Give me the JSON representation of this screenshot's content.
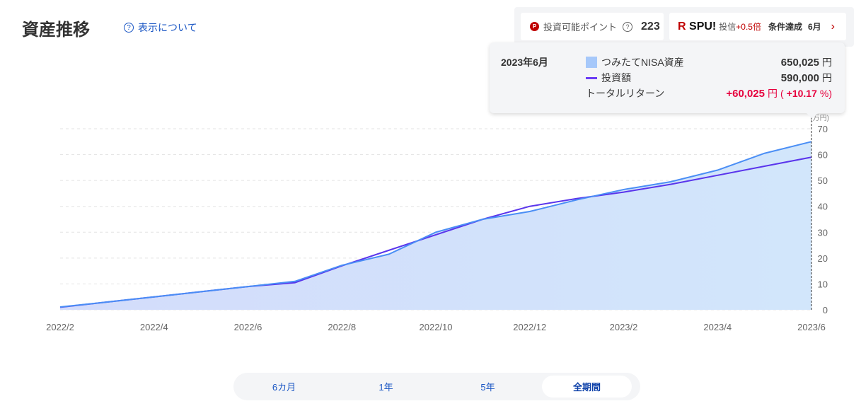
{
  "header": {
    "title": "資産推移",
    "help_link": "表示について",
    "help_icon": "question-circle-icon"
  },
  "points": {
    "label": "投資可能ポイント",
    "value": "223",
    "icon": "P"
  },
  "spu": {
    "logo_r": "R",
    "logo_text": "SPU!",
    "label": "投信",
    "bonus": "+0.5倍",
    "status": "条件達成",
    "month": "6月"
  },
  "tooltip": {
    "date": "2023年6月",
    "asset_label": "つみたてNISA資産",
    "asset_value": "650,025",
    "investment_label": "投資額",
    "investment_value": "590,000",
    "return_label": "トータルリターン",
    "return_value": "+60,025",
    "return_pct": "+10.17",
    "currency": "円",
    "pct_unit": "%",
    "paren_open": "(",
    "paren_close": ")"
  },
  "tabs": [
    {
      "label": "6カ月"
    },
    {
      "label": "1年"
    },
    {
      "label": "5年"
    },
    {
      "label": "全期間",
      "active": true
    }
  ],
  "chart_data": {
    "type": "area",
    "unit_label": "(万円)",
    "x": [
      "2022/2",
      "2022/3",
      "2022/4",
      "2022/5",
      "2022/6",
      "2022/7",
      "2022/8",
      "2022/9",
      "2022/10",
      "2022/11",
      "2022/12",
      "2023/1",
      "2023/2",
      "2023/3",
      "2023/4",
      "2023/5",
      "2023/6"
    ],
    "x_tick_labels": [
      "2022/2",
      "2022/4",
      "2022/6",
      "2022/8",
      "2022/10",
      "2022/12",
      "2023/2",
      "2023/4",
      "2023/6"
    ],
    "y_ticks": [
      "0",
      "10",
      "20",
      "30",
      "40",
      "50",
      "60",
      "70"
    ],
    "ylim": [
      0,
      70
    ],
    "series": [
      {
        "name": "つみたてNISA資産",
        "type": "area",
        "color": "#4a8ef5",
        "fill": "#cfe0fb",
        "values": [
          1.1,
          3.0,
          5.0,
          7.0,
          9.0,
          11.0,
          17.2,
          21.5,
          30.0,
          35.0,
          38.0,
          42.5,
          46.5,
          49.5,
          54.0,
          60.5,
          65.0
        ]
      },
      {
        "name": "投資額",
        "type": "line",
        "color": "#5a35ec",
        "values": [
          1.0,
          3.0,
          5.0,
          7.0,
          9.0,
          10.5,
          17.0,
          23.0,
          29.0,
          35.0,
          40.0,
          43.0,
          45.5,
          48.5,
          52.0,
          55.5,
          59.0
        ]
      }
    ],
    "grid": true,
    "highlight": "2023/6"
  }
}
